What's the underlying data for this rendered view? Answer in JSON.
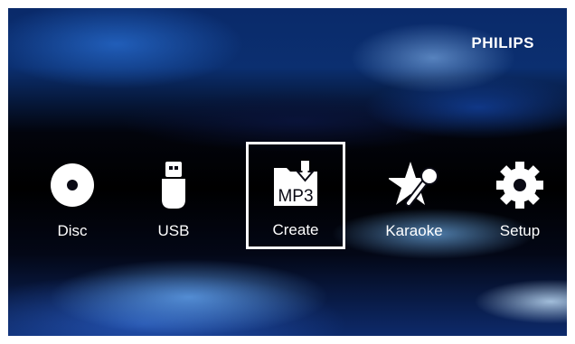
{
  "brand": {
    "name": "PHILIPS"
  },
  "menu": {
    "items": [
      {
        "label": "Disc",
        "icon": "disc-icon",
        "selected": false
      },
      {
        "label": "USB",
        "icon": "usb-drive-icon",
        "selected": false
      },
      {
        "label": "Create",
        "icon": "create-mp3-icon",
        "icon_text": "MP3",
        "selected": true
      },
      {
        "label": "Karaoke",
        "icon": "karaoke-microphone-icon",
        "selected": false
      },
      {
        "label": "Setup",
        "icon": "gear-icon",
        "selected": false
      }
    ]
  },
  "colors": {
    "text": "#ffffff",
    "selection_border": "#ffffff"
  }
}
